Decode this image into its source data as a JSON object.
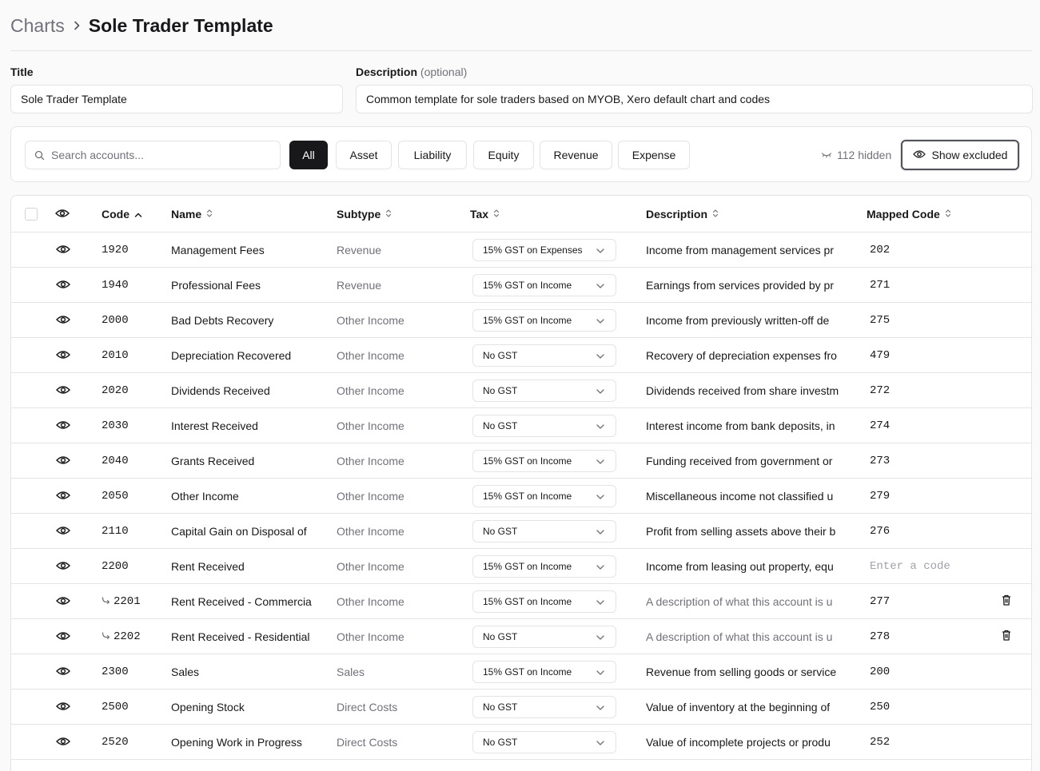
{
  "breadcrumb": {
    "parent": "Charts",
    "current": "Sole Trader Template"
  },
  "form": {
    "title_label": "Title",
    "title_value": "Sole Trader Template",
    "description_label": "Description",
    "description_optional": "(optional)",
    "description_value": "Common template for sole traders based on MYOB, Xero default chart and codes"
  },
  "toolbar": {
    "search_placeholder": "Search accounts...",
    "filters": [
      "All",
      "Asset",
      "Liability",
      "Equity",
      "Revenue",
      "Expense"
    ],
    "active_filter": "All",
    "hidden_count": "112 hidden",
    "show_excluded_label": "Show excluded"
  },
  "table": {
    "headers": {
      "code": "Code",
      "name": "Name",
      "subtype": "Subtype",
      "tax": "Tax",
      "description": "Description",
      "mapped_code": "Mapped Code"
    },
    "mapped_placeholder": "Enter a code",
    "rows": [
      {
        "code": "1920",
        "sub": false,
        "name": "Management Fees",
        "subtype": "Revenue",
        "tax": "15% GST on Expenses",
        "description": "Income from management services pr",
        "desc_placeholder": false,
        "mapped": "202",
        "deletable": false
      },
      {
        "code": "1940",
        "sub": false,
        "name": "Professional Fees",
        "subtype": "Revenue",
        "tax": "15% GST on Income",
        "description": "Earnings from services provided by pr",
        "desc_placeholder": false,
        "mapped": "271",
        "deletable": false
      },
      {
        "code": "2000",
        "sub": false,
        "name": "Bad Debts Recovery",
        "subtype": "Other Income",
        "tax": "15% GST on Income",
        "description": "Income from previously written-off de",
        "desc_placeholder": false,
        "mapped": "275",
        "deletable": false
      },
      {
        "code": "2010",
        "sub": false,
        "name": "Depreciation Recovered",
        "subtype": "Other Income",
        "tax": "No GST",
        "description": "Recovery of depreciation expenses fro",
        "desc_placeholder": false,
        "mapped": "479",
        "deletable": false
      },
      {
        "code": "2020",
        "sub": false,
        "name": "Dividends Received",
        "subtype": "Other Income",
        "tax": "No GST",
        "description": "Dividends received from share investm",
        "desc_placeholder": false,
        "mapped": "272",
        "deletable": false
      },
      {
        "code": "2030",
        "sub": false,
        "name": "Interest Received",
        "subtype": "Other Income",
        "tax": "No GST",
        "description": "Interest income from bank deposits, in",
        "desc_placeholder": false,
        "mapped": "274",
        "deletable": false
      },
      {
        "code": "2040",
        "sub": false,
        "name": "Grants Received",
        "subtype": "Other Income",
        "tax": "15% GST on Income",
        "description": "Funding received from government or",
        "desc_placeholder": false,
        "mapped": "273",
        "deletable": false
      },
      {
        "code": "2050",
        "sub": false,
        "name": "Other Income",
        "subtype": "Other Income",
        "tax": "15% GST on Income",
        "description": "Miscellaneous income not classified u",
        "desc_placeholder": false,
        "mapped": "279",
        "deletable": false
      },
      {
        "code": "2110",
        "sub": false,
        "name": "Capital Gain on Disposal of",
        "subtype": "Other Income",
        "tax": "No GST",
        "description": "Profit from selling assets above their b",
        "desc_placeholder": false,
        "mapped": "276",
        "deletable": false
      },
      {
        "code": "2200",
        "sub": false,
        "name": "Rent Received",
        "subtype": "Other Income",
        "tax": "15% GST on Income",
        "description": "Income from leasing out property, equ",
        "desc_placeholder": false,
        "mapped": "",
        "deletable": false
      },
      {
        "code": "2201",
        "sub": true,
        "name": "Rent Received - Commercia",
        "subtype": "Other Income",
        "tax": "15% GST on Income",
        "description": "A description of what this account is u",
        "desc_placeholder": true,
        "mapped": "277",
        "deletable": true
      },
      {
        "code": "2202",
        "sub": true,
        "name": "Rent Received - Residential",
        "subtype": "Other Income",
        "tax": "No GST",
        "description": "A description of what this account is u",
        "desc_placeholder": true,
        "mapped": "278",
        "deletable": true
      },
      {
        "code": "2300",
        "sub": false,
        "name": "Sales",
        "subtype": "Sales",
        "tax": "15% GST on Income",
        "description": "Revenue from selling goods or service",
        "desc_placeholder": false,
        "mapped": "200",
        "deletable": false
      },
      {
        "code": "2500",
        "sub": false,
        "name": "Opening Stock",
        "subtype": "Direct Costs",
        "tax": "No GST",
        "description": "Value of inventory at the beginning of",
        "desc_placeholder": false,
        "mapped": "250",
        "deletable": false
      },
      {
        "code": "2520",
        "sub": false,
        "name": "Opening Work in Progress",
        "subtype": "Direct Costs",
        "tax": "No GST",
        "description": "Value of incomplete projects or produ",
        "desc_placeholder": false,
        "mapped": "252",
        "deletable": false
      }
    ]
  },
  "icons": {
    "visible": "eye-icon",
    "hidden": "eye-off-icon",
    "search": "search-icon",
    "delete": "trash-icon",
    "sort": "chevron-up-down-icon",
    "sub_account": "corner-down-right-icon"
  }
}
